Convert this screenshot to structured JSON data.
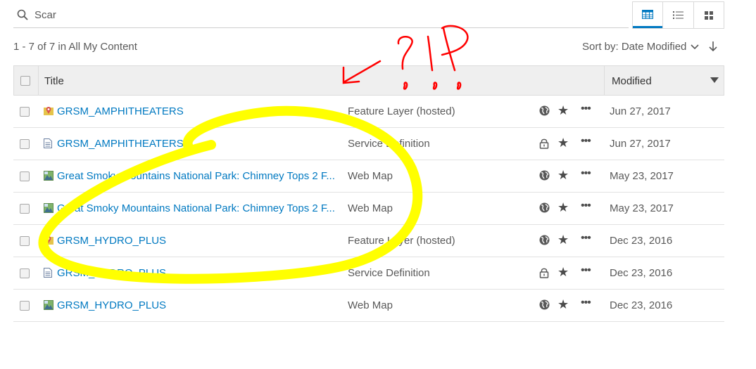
{
  "search": {
    "value": "Scar",
    "icon": "search-icon"
  },
  "view_buttons": [
    {
      "name": "table-view",
      "icon": "table-view-icon",
      "active": true
    },
    {
      "name": "list-view",
      "icon": "list-view-icon",
      "active": false
    },
    {
      "name": "grid-view",
      "icon": "grid-view-icon",
      "active": false
    }
  ],
  "results": {
    "count_text": "1 - 7 of 7 in All My Content"
  },
  "sort": {
    "label": "Sort by: Date Modified",
    "direction_icon": "arrow-down-icon"
  },
  "table": {
    "headers": {
      "title": "Title",
      "modified": "Modified"
    },
    "rows": [
      {
        "title": "GRSM_AMPHITHEATERS",
        "type": "Feature Layer (hosted)",
        "share": "globe",
        "date": "Jun 27, 2017",
        "icon": "feature-layer-icon"
      },
      {
        "title": "GRSM_AMPHITHEATERS",
        "type": "Service Definition",
        "share": "lock",
        "date": "Jun 27, 2017",
        "icon": "service-definition-icon"
      },
      {
        "title": "Great Smoky Mountains National Park: Chimney Tops 2 F...",
        "type": "Web Map",
        "share": "globe",
        "date": "May 23, 2017",
        "icon": "web-map-icon"
      },
      {
        "title": "Great Smoky Mountains National Park: Chimney Tops 2 F...",
        "type": "Web Map",
        "share": "globe",
        "date": "May 23, 2017",
        "icon": "web-map-icon"
      },
      {
        "title": "GRSM_HYDRO_PLUS",
        "type": "Feature Layer (hosted)",
        "share": "globe",
        "date": "Dec 23, 2016",
        "icon": "feature-layer-icon"
      },
      {
        "title": "GRSM_HYDRO_PLUS",
        "type": "Service Definition",
        "share": "lock",
        "date": "Dec 23, 2016",
        "icon": "service-definition-icon"
      },
      {
        "title": "GRSM_HYDRO_PLUS",
        "type": "Web Map",
        "share": "globe",
        "date": "Dec 23, 2016",
        "icon": "web-map-icon"
      }
    ],
    "row_actions": {
      "favorite": "★",
      "more": "•••"
    }
  },
  "colors": {
    "link": "#0079c1",
    "accent": "#0079c1",
    "highlight": "#ffff00",
    "annotation": "#ff0000"
  }
}
